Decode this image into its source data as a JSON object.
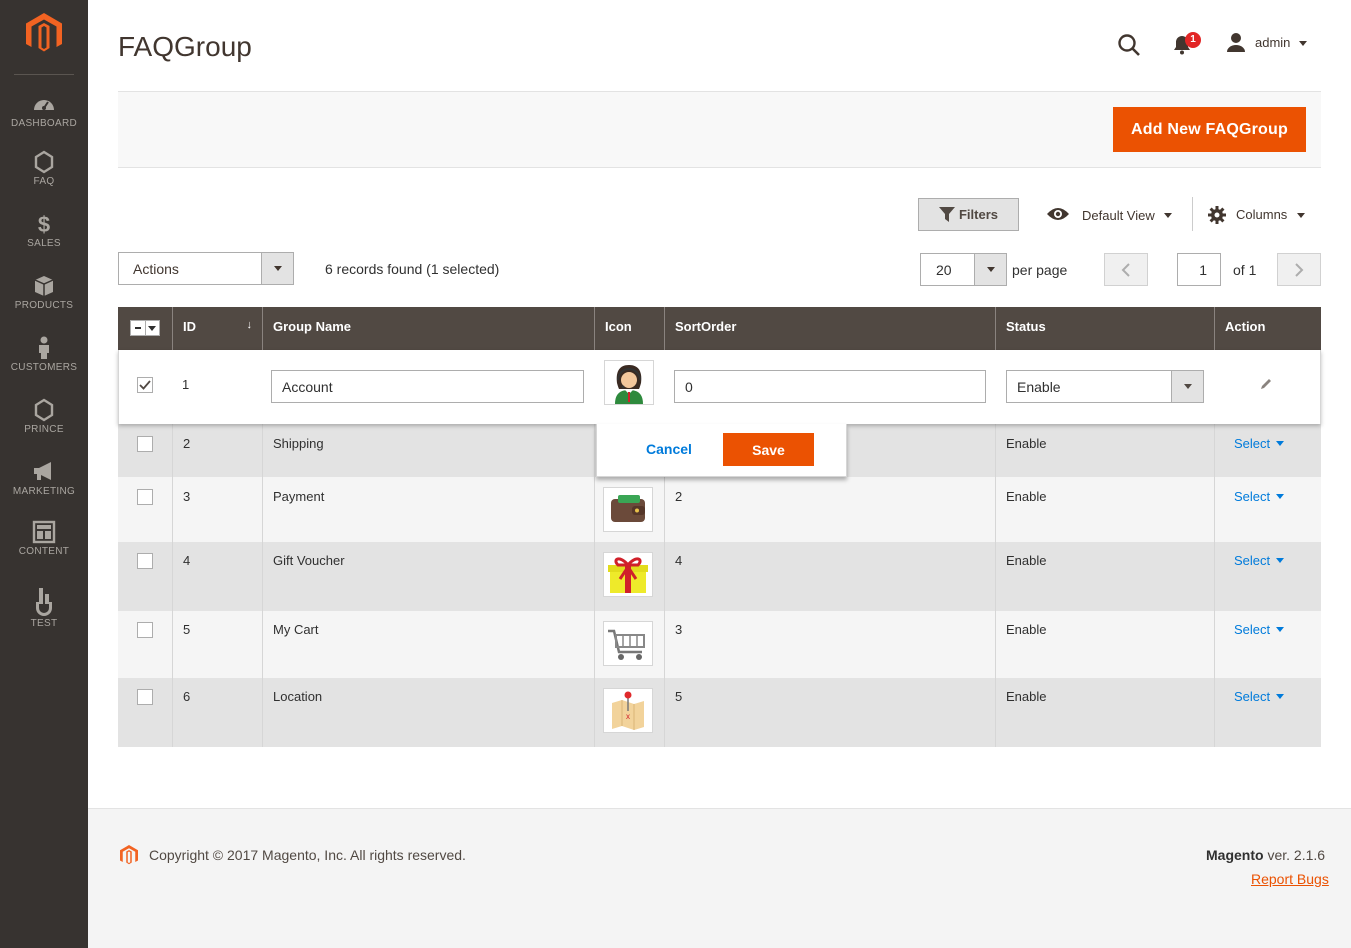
{
  "sidebar": {
    "items": [
      {
        "label": "DASHBOARD",
        "icon": "dashboard-icon"
      },
      {
        "label": "FAQ",
        "icon": "hexagon-icon"
      },
      {
        "label": "SALES",
        "icon": "dollar-icon"
      },
      {
        "label": "PRODUCTS",
        "icon": "box-icon"
      },
      {
        "label": "CUSTOMERS",
        "icon": "person-icon"
      },
      {
        "label": "PRINCE",
        "icon": "hexagon-icon"
      },
      {
        "label": "MARKETING",
        "icon": "megaphone-icon"
      },
      {
        "label": "CONTENT",
        "icon": "layout-icon"
      },
      {
        "label": "TEST",
        "icon": "fork-icon"
      }
    ]
  },
  "header": {
    "title": "FAQGroup",
    "notification_count": "1",
    "user": "admin"
  },
  "page_actions": {
    "add_label": "Add New FAQGroup"
  },
  "toolbar": {
    "filters_label": "Filters",
    "view_label": "Default View",
    "columns_label": "Columns",
    "actions_label": "Actions",
    "records_info": "6 records found (1 selected)",
    "per_page_value": "20",
    "per_page_label": "per page",
    "current_page": "1",
    "of_pages": "of 1"
  },
  "grid": {
    "columns": [
      "ID",
      "Group Name",
      "Icon",
      "SortOrder",
      "Status",
      "Action"
    ],
    "sort_indicator": "↓",
    "editing": {
      "id": "1",
      "group_name": "Account",
      "sort_order": "0",
      "status": "Enable",
      "cancel_label": "Cancel",
      "save_label": "Save"
    },
    "rows": [
      {
        "id": "2",
        "name": "Shipping",
        "sort": "",
        "status": "Enable",
        "action": "Select"
      },
      {
        "id": "3",
        "name": "Payment",
        "sort": "2",
        "status": "Enable",
        "action": "Select"
      },
      {
        "id": "4",
        "name": "Gift Voucher",
        "sort": "4",
        "status": "Enable",
        "action": "Select"
      },
      {
        "id": "5",
        "name": "My Cart",
        "sort": "3",
        "status": "Enable",
        "action": "Select"
      },
      {
        "id": "6",
        "name": "Location",
        "sort": "5",
        "status": "Enable",
        "action": "Select"
      }
    ]
  },
  "footer": {
    "copyright": "Copyright © 2017 Magento, Inc. All rights reserved.",
    "brand": "Magento",
    "version": " ver. 2.1.6",
    "report_bugs": "Report Bugs"
  },
  "colors": {
    "accent": "#eb5202",
    "sidebar": "#373330",
    "grid_header": "#514943",
    "link": "#007bdb"
  }
}
